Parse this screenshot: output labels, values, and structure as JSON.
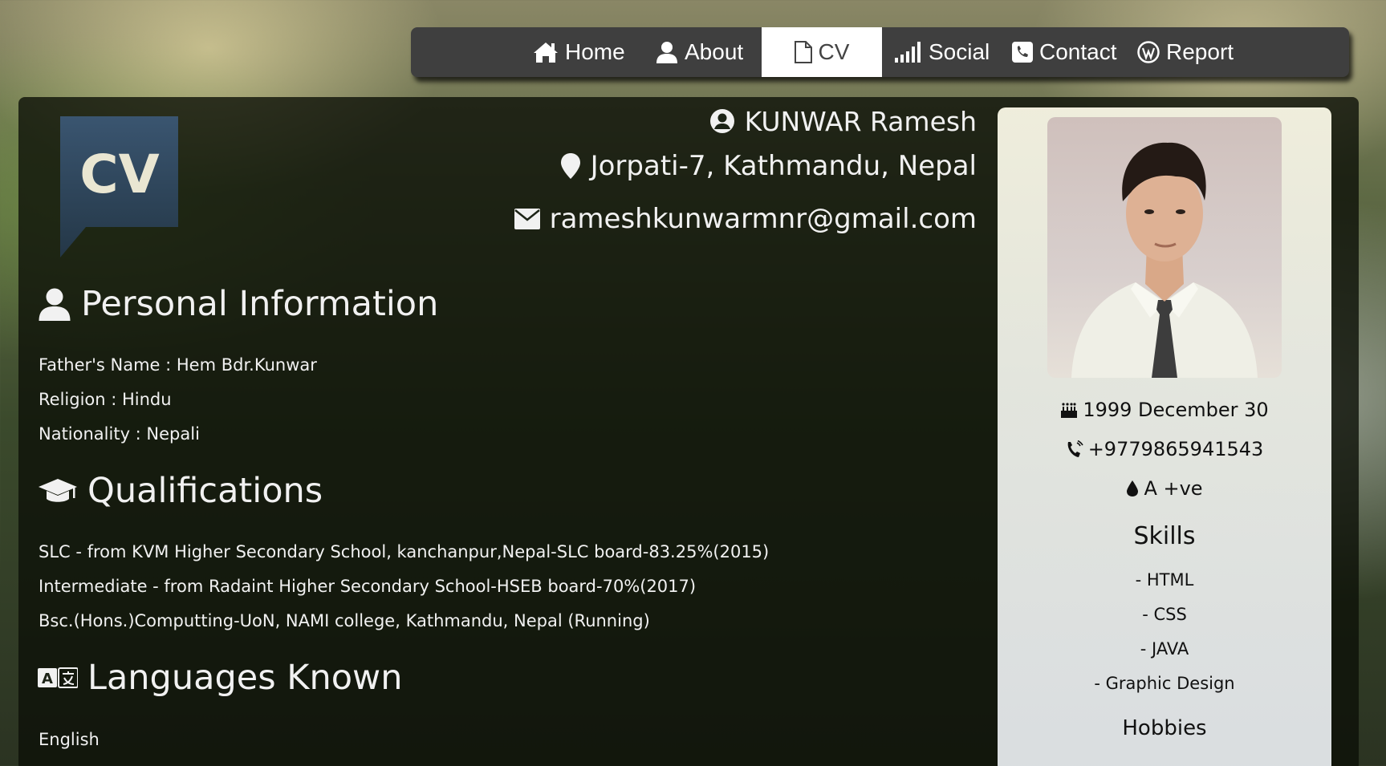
{
  "nav": {
    "items": [
      {
        "label": "Home",
        "icon": "home-icon"
      },
      {
        "label": "About",
        "icon": "user-icon"
      },
      {
        "label": "CV",
        "icon": "file-icon",
        "active": true
      },
      {
        "label": "Social",
        "icon": "signal-icon"
      },
      {
        "label": "Contact",
        "icon": "phone-square-icon"
      },
      {
        "label": "Report",
        "icon": "wordpress-icon"
      }
    ]
  },
  "logo": {
    "text": "CV"
  },
  "header": {
    "name": "KUNWAR Ramesh",
    "address": "Jorpati-7, Kathmandu, Nepal",
    "email": "rameshkunwarmnr@gmail.com"
  },
  "personal": {
    "title": "Personal Information",
    "lines": [
      "Father's Name : Hem Bdr.Kunwar",
      "Religion : Hindu",
      "Nationality : Nepali"
    ]
  },
  "qualifications": {
    "title": "Qualifications",
    "lines": [
      "SLC - from KVM Higher Secondary School, kanchanpur,Nepal-SLC board-83.25%(2015)",
      "Intermediate - from Radaint Higher Secondary School-HSEB board-70%(2017)",
      "Bsc.(Hons.)Computting-UoN, NAMI college, Kathmandu, Nepal (Running)"
    ]
  },
  "languages": {
    "title": "Languages Known",
    "lines": [
      "English"
    ]
  },
  "side": {
    "dob": "1999 December 30",
    "phone": "+9779865941543",
    "blood": "A +ve",
    "skills_title": "Skills",
    "skills": [
      "- HTML",
      "- CSS",
      "- JAVA",
      "- Graphic Design"
    ],
    "hobbies_title": "Hobbies"
  },
  "colors": {
    "nav_bg": "#3f3f3f",
    "nav_active_bg": "#ffffff",
    "panel_bg": "#0c1008",
    "text_light": "#f1f1f1",
    "card_bg": "#f6f5ea",
    "logo_bg": "#2c4257"
  }
}
